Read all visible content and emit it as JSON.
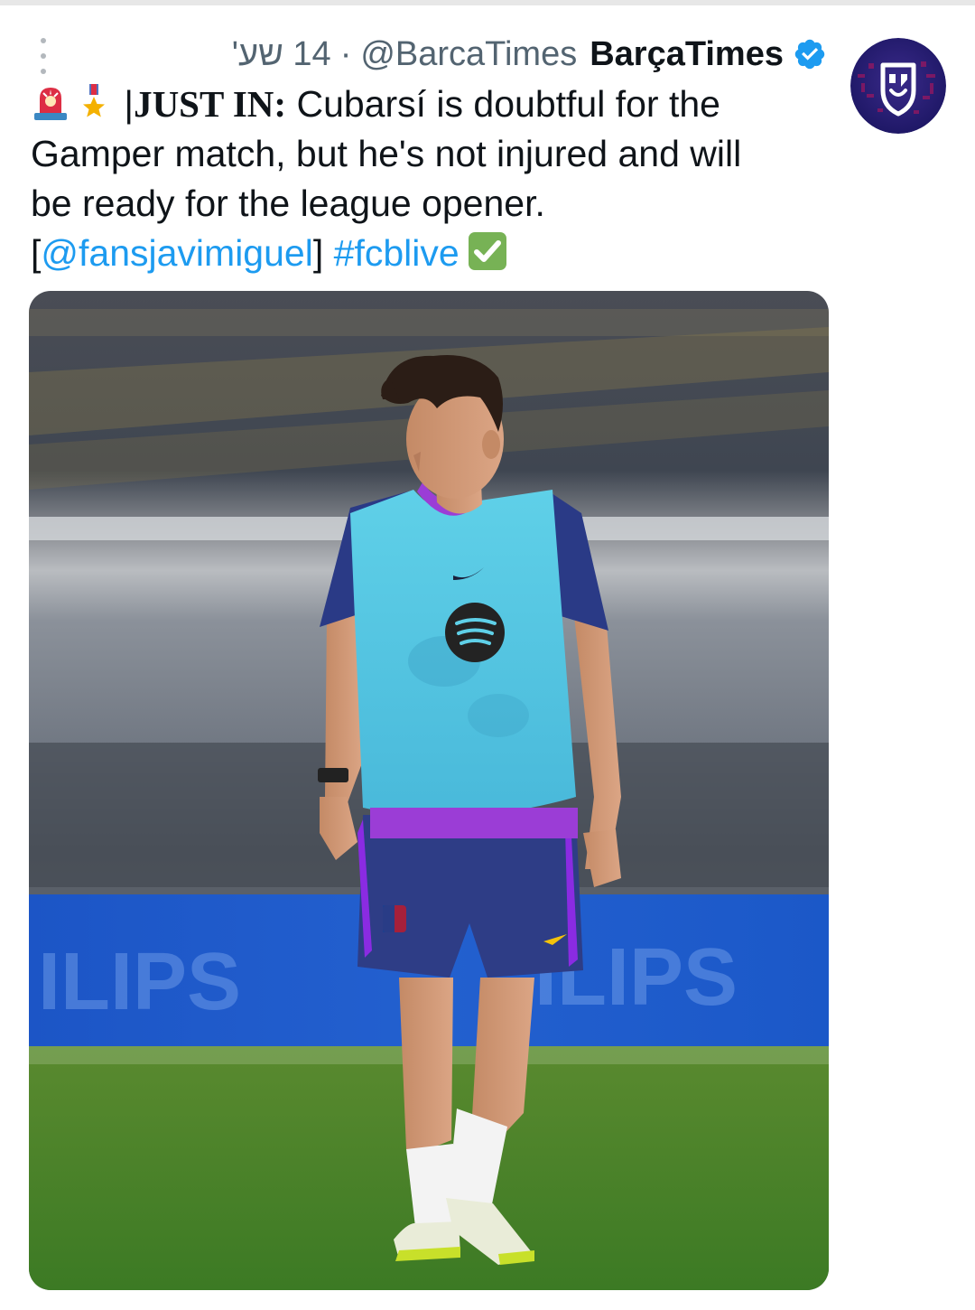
{
  "tweet": {
    "time": "14 שע'",
    "separator": "·",
    "handle": "@BarcaTimes",
    "display_name": "BarçaTimes",
    "text": {
      "just_in": "JUST IN:",
      "pipe": "|",
      "line1_rest": "Cubarsí is doubtful for the",
      "line2": "Gamper match, but he's not injured and will",
      "line3": "be ready for the league opener.",
      "bracket_open": "[",
      "mention": "@fansjavimiguel",
      "bracket_close": "]",
      "hashtag": "#fcblive"
    },
    "icons": {
      "alert": "police-siren-emoji",
      "medal": "military-medal-emoji",
      "check": "check-mark-emoji",
      "verified": "verified-badge-icon",
      "more": "more-options-icon"
    },
    "colors": {
      "link": "#1d9bf0",
      "verified": "#1d9bf0",
      "meta": "#536471",
      "text": "#0f1419",
      "check_emoji": "#77b255"
    }
  }
}
